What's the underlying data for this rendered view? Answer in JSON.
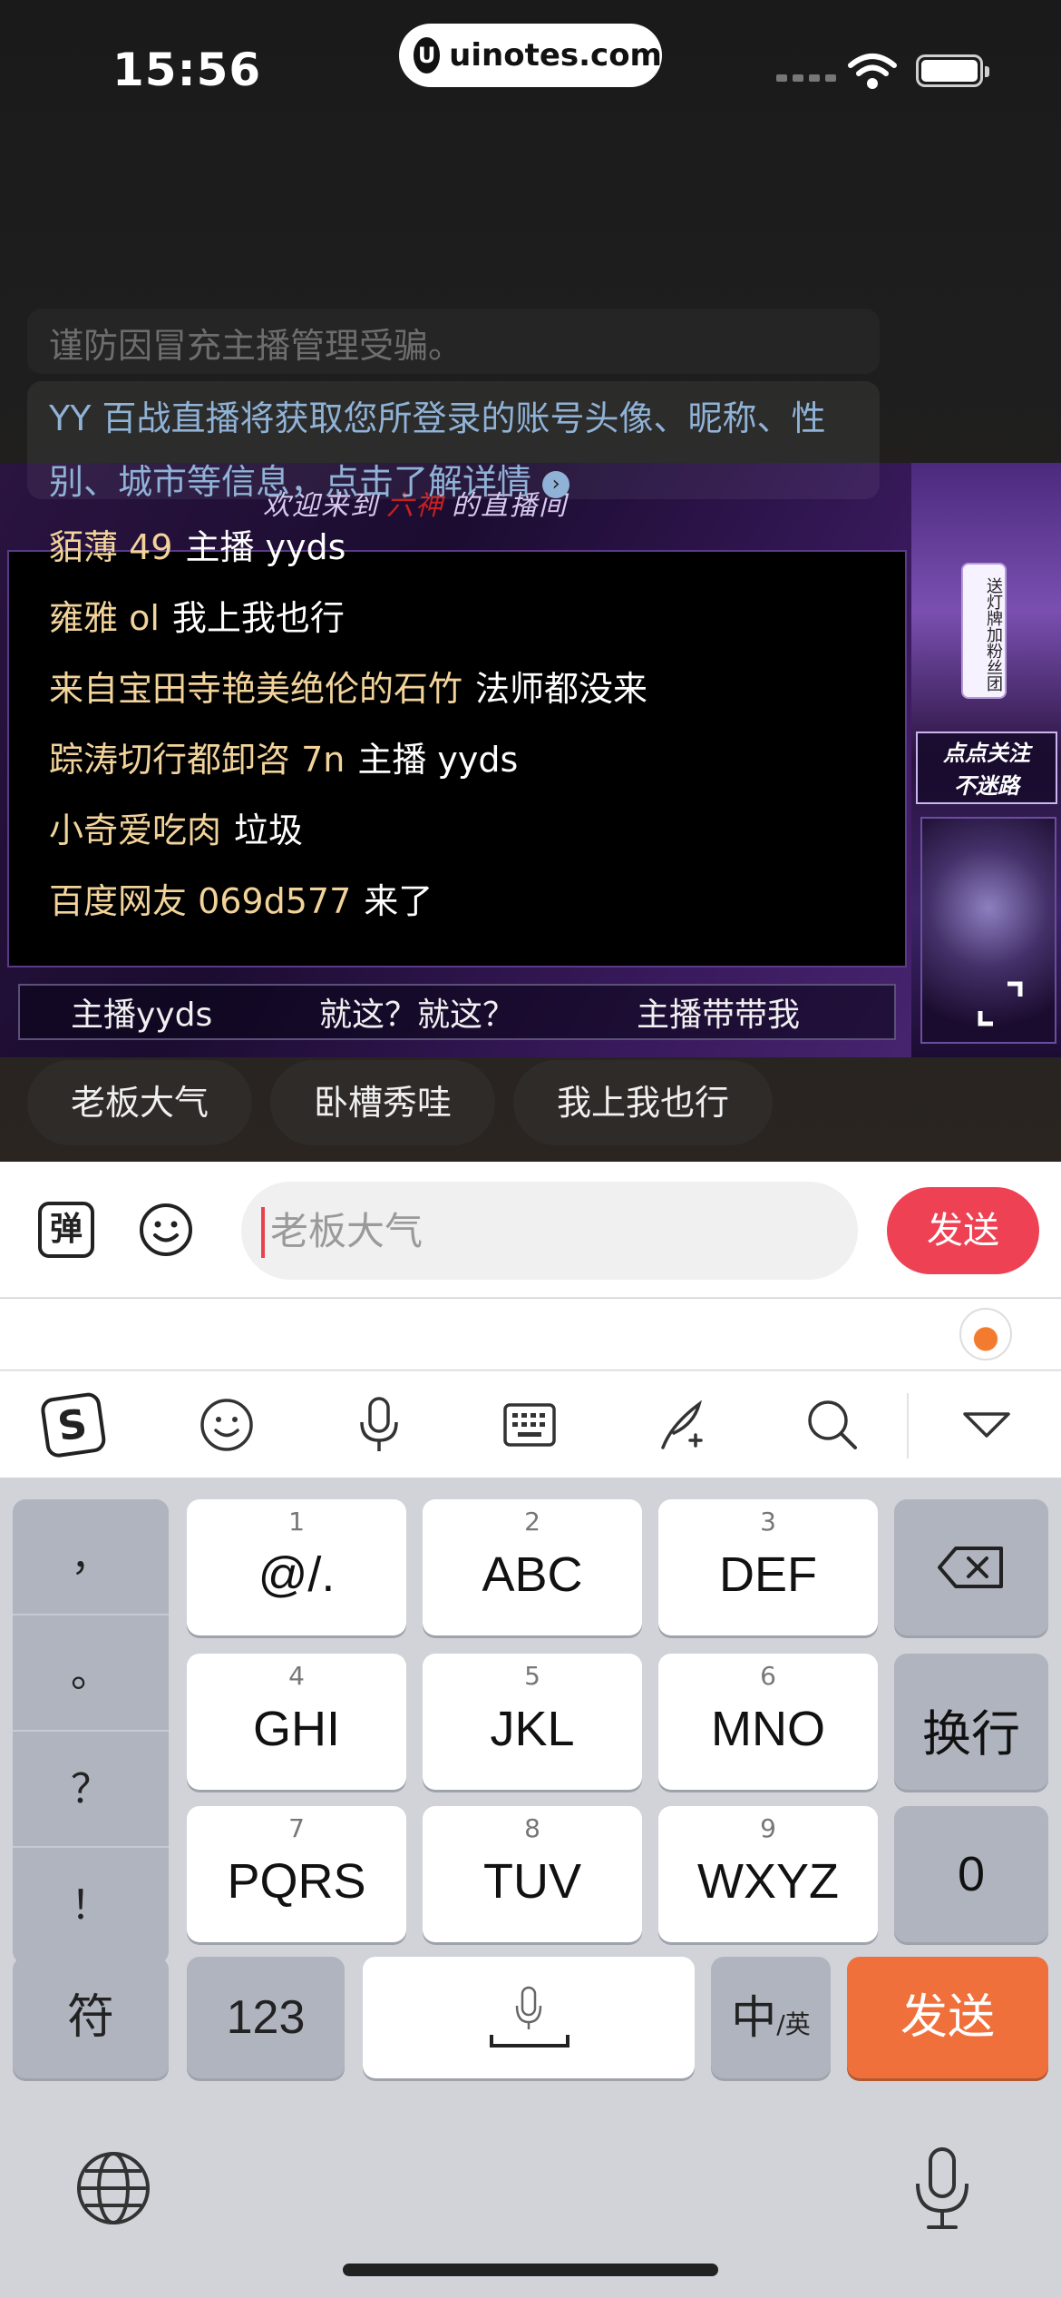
{
  "status_bar": {
    "time": "15:56",
    "url": "uinotes.com",
    "url_logo": "U"
  },
  "notices": {
    "warning": "谨防因冒充主播管理受骗。",
    "privacy": "YY 百战直播将获取您所登录的账号头像、昵称、性别、城市等信息，点击了解详情",
    "privacy_arrow": "›"
  },
  "stream": {
    "banner_prefix": "欢迎来到",
    "banner_name": "六神",
    "banner_suffix": "的直播间",
    "fan_tag": "送灯牌加粉丝团",
    "follow_tag_line1": "点点关注",
    "follow_tag_line2": "不迷路"
  },
  "chat": [
    {
      "user": "貊薄 49",
      "msg": "主播 yyds"
    },
    {
      "user": "雍雅 ol",
      "msg": "我上我也行"
    },
    {
      "user": "来自宝田寺艳美绝伦的石竹",
      "msg": "法师都没来"
    },
    {
      "user": "踪涛切行都卸咨 7n",
      "msg": "主播 yyds"
    },
    {
      "user": "小奇爱吃肉",
      "msg": "垃圾"
    },
    {
      "user": "百度网友 069d577",
      "msg": "来了"
    }
  ],
  "quick_phrases": [
    "主播yyds",
    "就这？就这？",
    "主播带带我"
  ],
  "chips": [
    "老板大气",
    "卧槽秀哇",
    "我上我也行"
  ],
  "input_bar": {
    "danmu_label": "弹",
    "placeholder": "老板大气",
    "send_label": "发送"
  },
  "keyboard": {
    "punctuation": [
      "，",
      "。",
      "？",
      "！"
    ],
    "keys": [
      {
        "num": "1",
        "label": "@/."
      },
      {
        "num": "2",
        "label": "ABC"
      },
      {
        "num": "3",
        "label": "DEF"
      },
      {
        "num": "4",
        "label": "GHI"
      },
      {
        "num": "5",
        "label": "JKL"
      },
      {
        "num": "6",
        "label": "MNO"
      },
      {
        "num": "7",
        "label": "PQRS"
      },
      {
        "num": "8",
        "label": "TUV"
      },
      {
        "num": "9",
        "label": "WXYZ"
      }
    ],
    "newline_label": "换行",
    "zero_label": "0",
    "symbol_label": "符",
    "numbers_label": "123",
    "lang_main": "中",
    "lang_sub": "/英",
    "send_label": "发送"
  },
  "colors": {
    "send_red": "#ee4254",
    "send_orange": "#f0703c",
    "chat_user": "#f2d39a",
    "notice_link": "#8fb2d6"
  }
}
